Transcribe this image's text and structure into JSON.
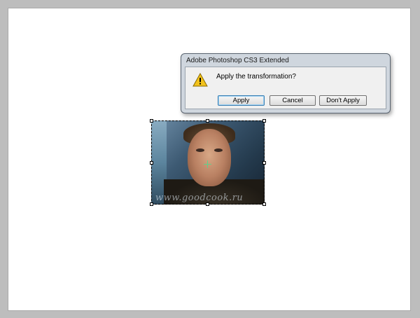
{
  "dialog": {
    "title": "Adobe Photoshop CS3 Extended",
    "message": "Apply the transformation?",
    "icon": "warning-icon",
    "buttons": {
      "apply": "Apply",
      "cancel": "Cancel",
      "dont_apply": "Don't Apply"
    }
  },
  "image": {
    "watermark": "www.goodcook.ru"
  },
  "colors": {
    "canvas": "#ffffff",
    "workspace": "#bdbdbd",
    "warning": "#f2c21b",
    "pivot": "#5fd08a"
  }
}
